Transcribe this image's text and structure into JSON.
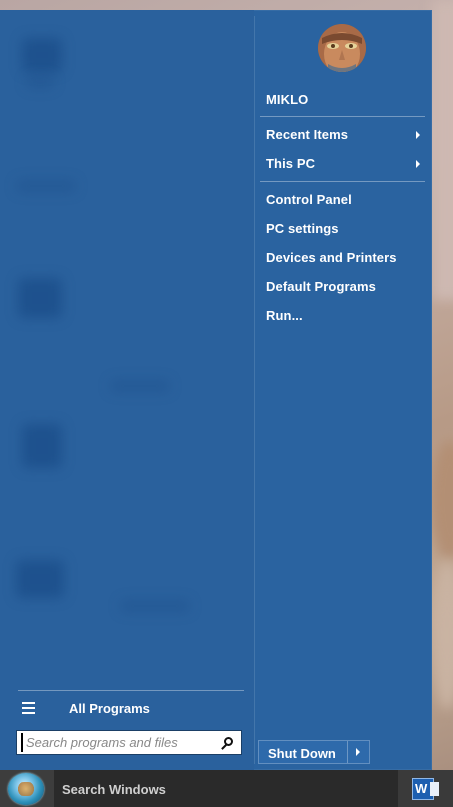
{
  "user": {
    "name": "MIKLO"
  },
  "right_menu": {
    "items": [
      {
        "label": "Recent Items",
        "submenu": true
      },
      {
        "label": "This PC",
        "submenu": true
      },
      {
        "label": "Control Panel",
        "submenu": false
      },
      {
        "label": "PC settings",
        "submenu": false
      },
      {
        "label": "Devices and Printers",
        "submenu": false
      },
      {
        "label": "Default Programs",
        "submenu": false
      },
      {
        "label": "Run...",
        "submenu": false
      }
    ]
  },
  "left_menu": {
    "all_programs_label": "All Programs",
    "all_programs_icon": "list-icon"
  },
  "search": {
    "placeholder": "Search programs and files",
    "value": ""
  },
  "shutdown": {
    "label": "Shut Down"
  },
  "taskbar": {
    "search_label": "Search Windows",
    "pinned": [
      {
        "icon": "word-icon",
        "glyph": "W"
      }
    ]
  },
  "colors": {
    "menu_bg": "#2a63a0",
    "taskbar_bg": "#2a2a2a"
  }
}
